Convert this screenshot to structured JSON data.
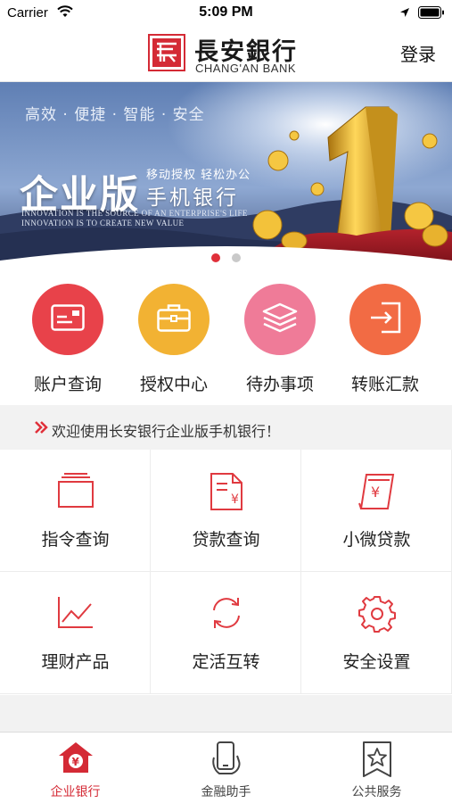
{
  "status_bar": {
    "carrier": "Carrier",
    "time": "5:09 PM"
  },
  "header": {
    "brand_cn": "長安銀行",
    "brand_en": "CHANG'AN BANK",
    "login_label": "登录"
  },
  "banner": {
    "tagline": "高效 · 便捷 · 智能 · 安全",
    "edition": "企业版",
    "slogan": "移动授权 轻松办公",
    "product": "手机银行",
    "innovation_line1": "INNOVATION IS THE SOURCE OF AN ENTERPRISE'S LIFE",
    "innovation_line2": "INNOVATION IS TO CREATE NEW VALUE",
    "page_count": 2,
    "active_page": 1
  },
  "quick_actions": [
    {
      "label": "账户查询",
      "icon": "card-icon",
      "color": "#e8424a"
    },
    {
      "label": "授权中心",
      "icon": "briefcase-icon",
      "color": "#f2b233"
    },
    {
      "label": "待办事项",
      "icon": "layers-icon",
      "color": "#ef7b98"
    },
    {
      "label": "转账汇款",
      "icon": "transfer-icon",
      "color": "#f26b44"
    }
  ],
  "notice": {
    "text": "欢迎使用长安银行企业版手机银行！"
  },
  "grid": [
    {
      "label": "指令查询",
      "icon": "stack-icon"
    },
    {
      "label": "贷款查询",
      "icon": "loan-document-icon"
    },
    {
      "label": "小微贷款",
      "icon": "cash-icon"
    },
    {
      "label": "理财产品",
      "icon": "chart-line-icon"
    },
    {
      "label": "定活互转",
      "icon": "refresh-icon"
    },
    {
      "label": "安全设置",
      "icon": "gear-icon"
    }
  ],
  "tabs": [
    {
      "label": "企业银行",
      "icon": "home-yuan-icon",
      "active": true
    },
    {
      "label": "金融助手",
      "icon": "phone-hand-icon",
      "active": false
    },
    {
      "label": "公共服务",
      "icon": "bookmark-star-icon",
      "active": false
    }
  ],
  "colors": {
    "accent": "#d42a35",
    "icon_red": "#e03a40"
  }
}
